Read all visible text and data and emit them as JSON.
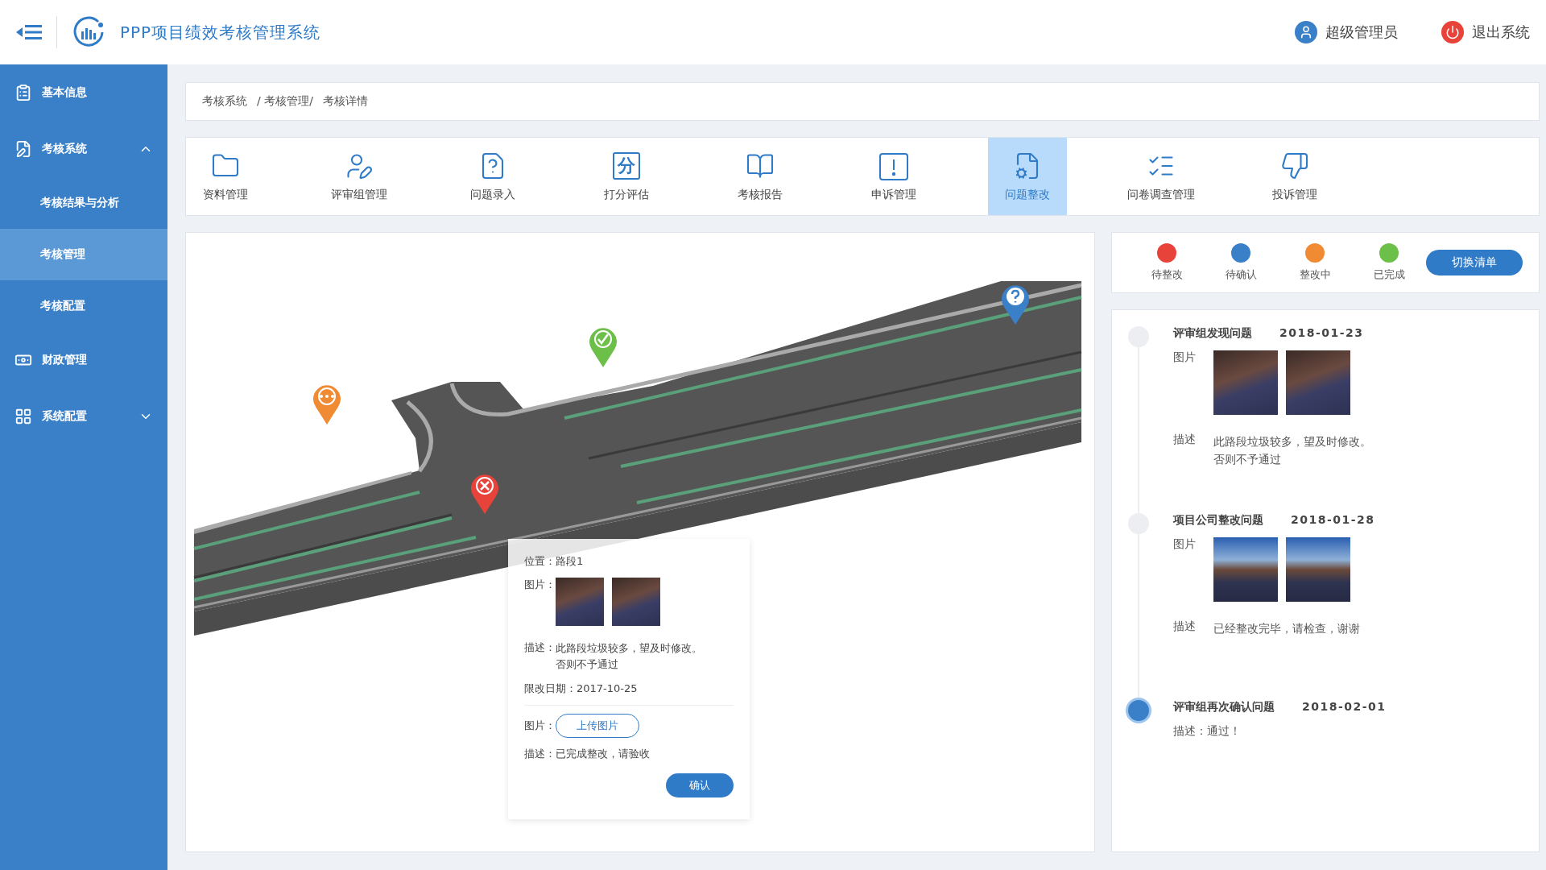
{
  "header": {
    "title": "PPP项目绩效考核管理系统",
    "user": "超级管理员",
    "logout": "退出系统"
  },
  "sidebar": {
    "items": [
      {
        "label": "基本信息"
      },
      {
        "label": "考核系统",
        "expanded": true,
        "children": [
          {
            "label": "考核结果与分析",
            "selected": false
          },
          {
            "label": "考核管理",
            "selected": true
          },
          {
            "label": "考核配置",
            "selected": false
          }
        ]
      },
      {
        "label": "财政管理"
      },
      {
        "label": "系统配置",
        "expanded": false
      }
    ]
  },
  "breadcrumb": [
    "考核系统",
    "/ 考核管理/",
    "考核详情"
  ],
  "toolbar": [
    {
      "label": "资料管理",
      "selected": false
    },
    {
      "label": "评审组管理",
      "selected": false
    },
    {
      "label": "问题录入",
      "selected": false
    },
    {
      "label": "打分评估",
      "glyph": "分",
      "selected": false
    },
    {
      "label": "考核报告",
      "selected": false
    },
    {
      "label": "申诉管理",
      "selected": false
    },
    {
      "label": "问题整改",
      "selected": true
    },
    {
      "label": "问卷调查管理",
      "selected": false
    },
    {
      "label": "投诉管理",
      "selected": false
    }
  ],
  "map": {
    "pins": [
      {
        "kind": "pending",
        "color": "#f08a33"
      },
      {
        "kind": "todo",
        "color": "#e8433a"
      },
      {
        "kind": "done",
        "color": "#6cc04a"
      },
      {
        "kind": "confirm",
        "color": "#3a80c8"
      }
    ],
    "popup": {
      "location": "位置：路段1",
      "photos_label": "图片：",
      "desc_label": "描述：",
      "desc": "此路段垃圾较多，望及时修改。否则不予通过",
      "deadline": "限改日期：2017-10-25",
      "upload_label": "图片：",
      "upload_button": "上传图片",
      "reply": "描述：已完成整改，请验收",
      "confirm_button": "确认"
    }
  },
  "legend": {
    "items": [
      {
        "label": "待整改",
        "color": "#e8433a"
      },
      {
        "label": "待确认",
        "color": "#3a80c8"
      },
      {
        "label": "整改中",
        "color": "#f08a33"
      },
      {
        "label": "已完成",
        "color": "#6cc04a"
      }
    ],
    "button": "切换清单"
  },
  "timeline": [
    {
      "kind": "detail",
      "title": "评审组发现问题",
      "date": "2018-01-23",
      "active": false,
      "photos_label": "图片",
      "desc_label": "描述",
      "desc": "此路段垃圾较多，望及时修改。否则不予通过"
    },
    {
      "kind": "detail",
      "title": "项目公司整改问题",
      "date": "2018-01-28",
      "active": false,
      "photos_label": "图片",
      "desc_label": "描述",
      "desc": "已经整改完毕，请检查，谢谢"
    },
    {
      "kind": "note",
      "title": "评审组再次确认问题",
      "date": "2018-02-01",
      "active": true,
      "desc": "描述：通过！"
    }
  ]
}
